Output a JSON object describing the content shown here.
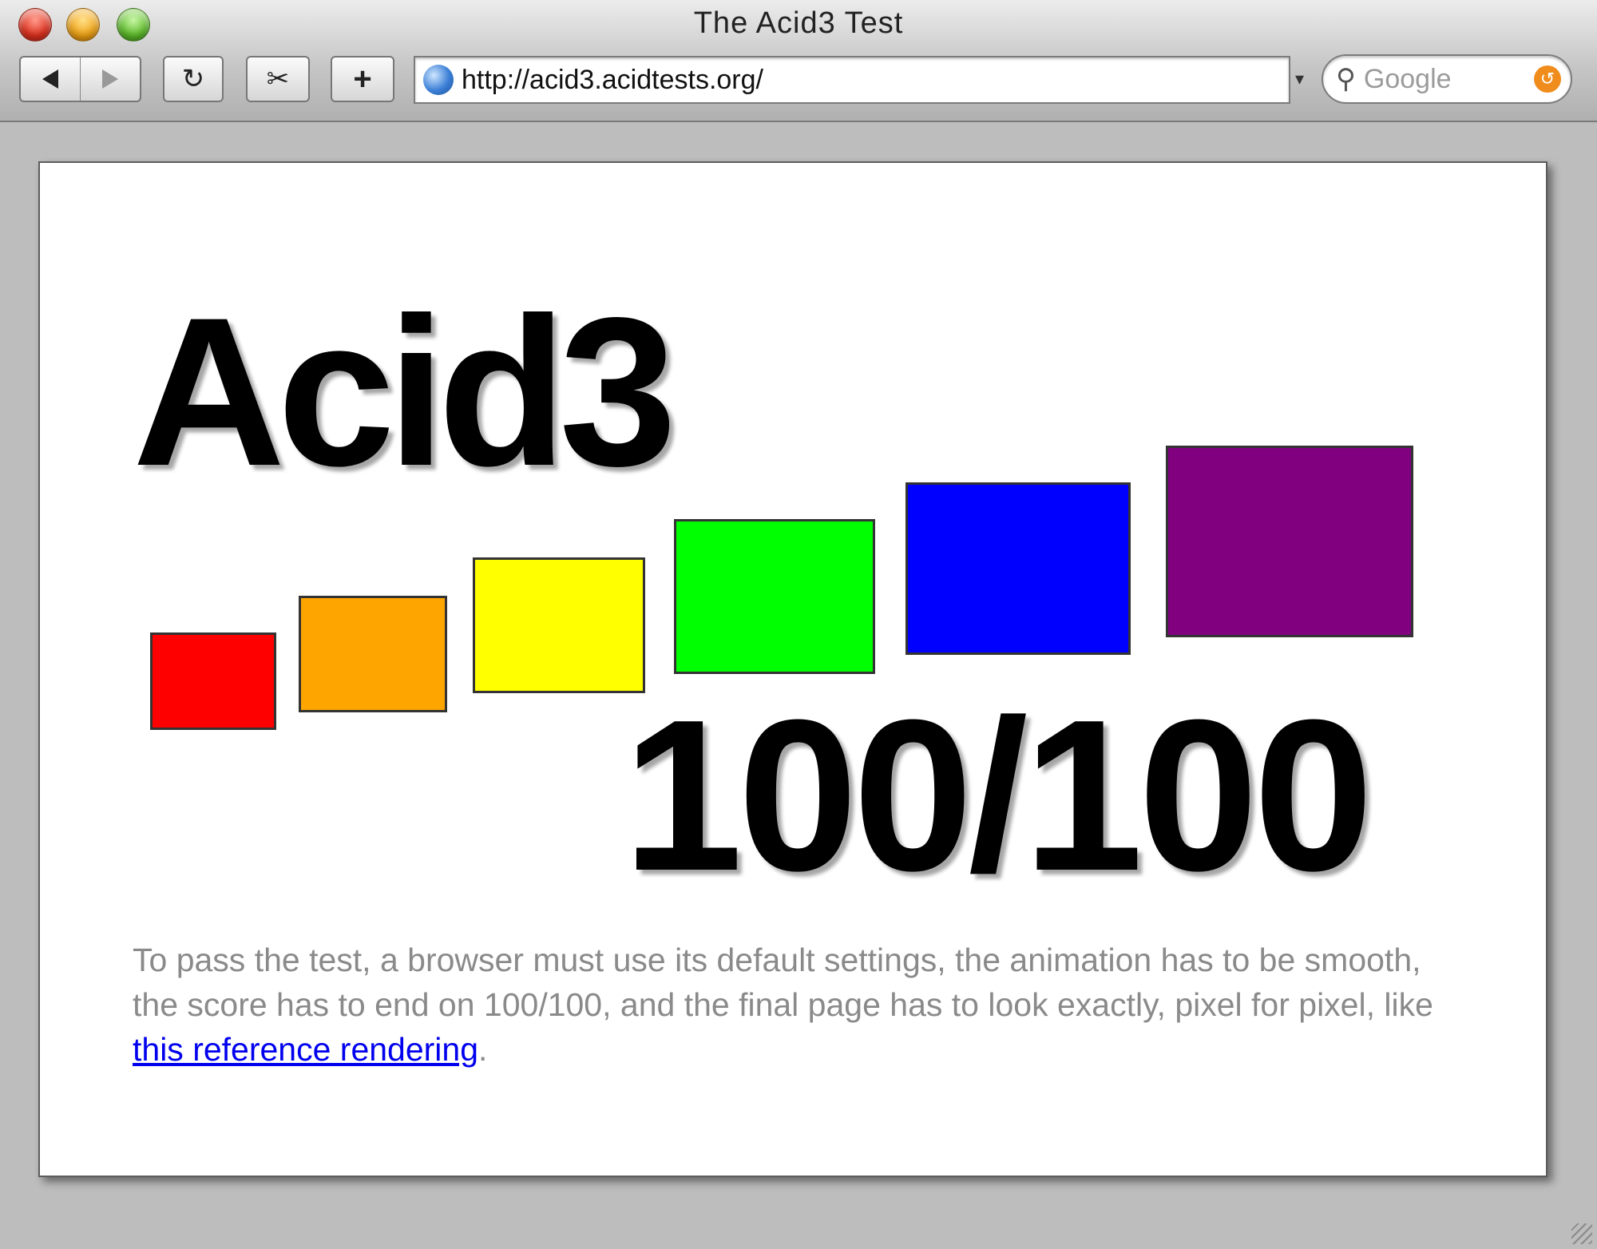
{
  "window": {
    "title": "The Acid3 Test"
  },
  "toolbar": {
    "back_icon": "back-arrow-icon",
    "forward_icon": "forward-arrow-icon",
    "reload_glyph": "↻",
    "snip_glyph": "✂",
    "add_glyph": "+",
    "url": "http://acid3.acidtests.org/",
    "search_placeholder": "Google",
    "search_icon_glyph": "⚲",
    "search_clear_glyph": "↺"
  },
  "page": {
    "title": "Acid3",
    "score": "100/100",
    "boxes": [
      {
        "color": "#ff0000"
      },
      {
        "color": "#ffa500"
      },
      {
        "color": "#ffff00"
      },
      {
        "color": "#00ff00"
      },
      {
        "color": "#0000ff"
      },
      {
        "color": "#800080"
      }
    ],
    "description_before": "To pass the test, a browser must use its default settings, the animation has to be smooth, the score has to end on 100/100, and the final page has to look exactly, pixel for pixel, like ",
    "description_link": "this reference rendering",
    "description_after": "."
  }
}
